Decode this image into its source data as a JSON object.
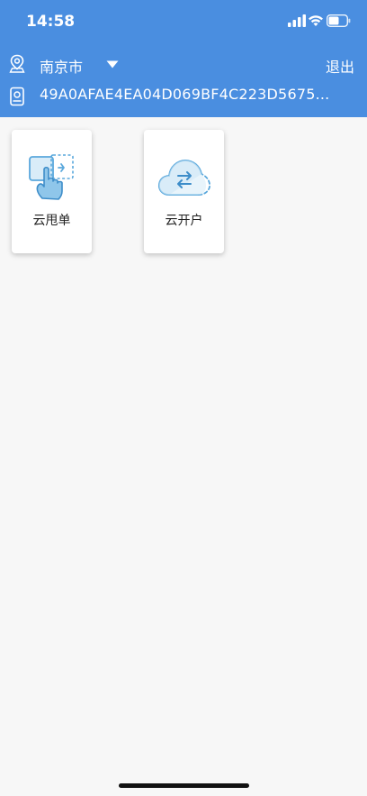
{
  "status_bar": {
    "time": "14:58"
  },
  "header": {
    "city": "南京市",
    "logout_label": "退出",
    "device_id": "49A0AFAE4EA04D069BF4C223D5675..."
  },
  "tiles": [
    {
      "label": "云甩单",
      "icon": "hand-swipe-icon"
    },
    {
      "label": "云开户",
      "icon": "cloud-sync-icon"
    }
  ],
  "colors": {
    "header_bg": "#4a8ee0",
    "icon_blue": "#5aa8dc"
  }
}
